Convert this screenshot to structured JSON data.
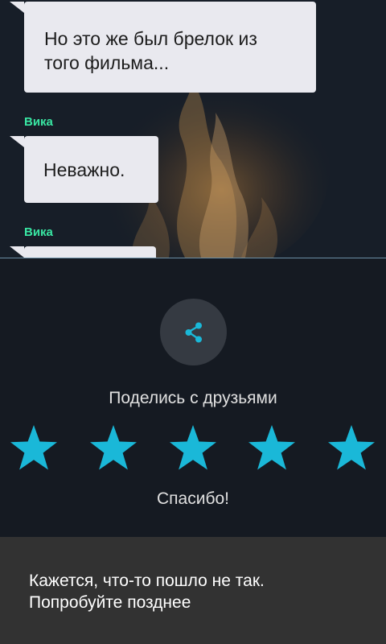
{
  "chat": {
    "messages": [
      {
        "text_line1": "Но это же был брелок из",
        "text_line2": "того фильма..."
      },
      {
        "sender": "Вика",
        "text": "Неважно."
      },
      {
        "sender": "Вика",
        "text": ""
      }
    ]
  },
  "rating": {
    "share_icon": "share-icon",
    "share_label": "Поделись с друзьями",
    "stars_total": 5,
    "stars_filled": 5,
    "thanks_label": "Спасибо!"
  },
  "snackbar": {
    "line1": "Кажется, что-то пошло не так.",
    "line2": "Попробуйте позднее"
  },
  "colors": {
    "background": "#151a22",
    "accent": "#1ab8d8",
    "sender_name": "#39e6a3",
    "bubble": "#e9e9ef",
    "snackbar": "#323232"
  }
}
